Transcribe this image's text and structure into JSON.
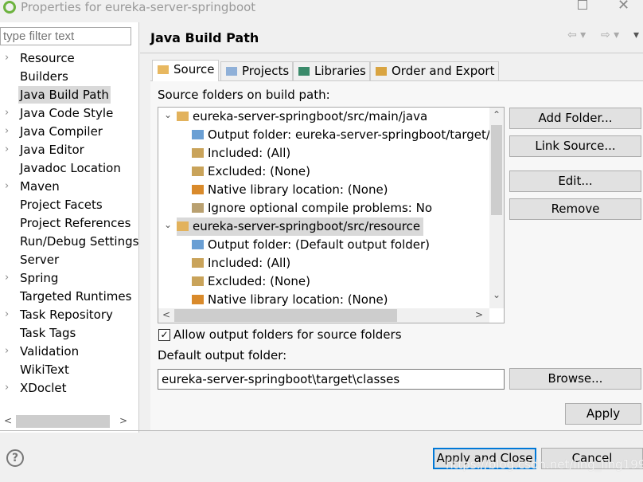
{
  "window": {
    "title": "Properties for eureka-server-springboot"
  },
  "filter": {
    "placeholder": "type filter text"
  },
  "nav": [
    {
      "label": "Resource",
      "expandable": true
    },
    {
      "label": "Builders",
      "expandable": false
    },
    {
      "label": "Java Build Path",
      "expandable": false,
      "selected": true
    },
    {
      "label": "Java Code Style",
      "expandable": true
    },
    {
      "label": "Java Compiler",
      "expandable": true
    },
    {
      "label": "Java Editor",
      "expandable": true
    },
    {
      "label": "Javadoc Location",
      "expandable": false
    },
    {
      "label": "Maven",
      "expandable": true
    },
    {
      "label": "Project Facets",
      "expandable": false
    },
    {
      "label": "Project References",
      "expandable": false
    },
    {
      "label": "Run/Debug Settings",
      "expandable": false
    },
    {
      "label": "Server",
      "expandable": false
    },
    {
      "label": "Spring",
      "expandable": true
    },
    {
      "label": "Targeted Runtimes",
      "expandable": false
    },
    {
      "label": "Task Repository",
      "expandable": true
    },
    {
      "label": "Task Tags",
      "expandable": false
    },
    {
      "label": "Validation",
      "expandable": true
    },
    {
      "label": "WikiText",
      "expandable": false
    },
    {
      "label": "XDoclet",
      "expandable": true
    }
  ],
  "page": {
    "title": "Java Build Path"
  },
  "tabs": [
    {
      "label": "Source",
      "active": true
    },
    {
      "label": "Projects"
    },
    {
      "label": "Libraries"
    },
    {
      "label": "Order and Export"
    }
  ],
  "source": {
    "label": "Source folders on build path:",
    "tree": [
      {
        "level": 0,
        "icon": "source-folder-icon",
        "text": "eureka-server-springboot/src/main/java"
      },
      {
        "level": 1,
        "icon": "output-folder-icon",
        "text": "Output folder: eureka-server-springboot/target/classes"
      },
      {
        "level": 1,
        "icon": "included-icon",
        "text": "Included: (All)"
      },
      {
        "level": 1,
        "icon": "excluded-icon",
        "text": "Excluded: (None)"
      },
      {
        "level": 1,
        "icon": "native-library-icon",
        "text": "Native library location: (None)"
      },
      {
        "level": 1,
        "icon": "ignore-problems-icon",
        "text": "Ignore optional compile problems: No"
      },
      {
        "level": 0,
        "icon": "source-folder-icon",
        "text": "eureka-server-springboot/src/resource",
        "selected": true
      },
      {
        "level": 1,
        "icon": "output-folder-icon",
        "text": "Output folder: (Default output folder)"
      },
      {
        "level": 1,
        "icon": "included-icon",
        "text": "Included: (All)"
      },
      {
        "level": 1,
        "icon": "excluded-icon",
        "text": "Excluded: (None)"
      },
      {
        "level": 1,
        "icon": "native-library-icon",
        "text": "Native library location: (None)"
      }
    ],
    "buttons": {
      "add_folder": "Add Folder...",
      "link_source": "Link Source...",
      "edit": "Edit...",
      "remove": "Remove"
    },
    "allow_output": {
      "label": "Allow output folders for source folders",
      "checked": true
    },
    "default_output_label": "Default output folder:",
    "default_output_value": "eureka-server-springboot\\target\\classes",
    "browse": "Browse..."
  },
  "apply": "Apply",
  "footer": {
    "apply_close": "Apply and Close",
    "cancel": "Cancel",
    "help": "?"
  },
  "watermark": "https://blog.csdn.net/ling_ling1997",
  "colors": {
    "accent": "#0078d7",
    "selection": "#d9d9d9",
    "spring": "#6db33f"
  }
}
